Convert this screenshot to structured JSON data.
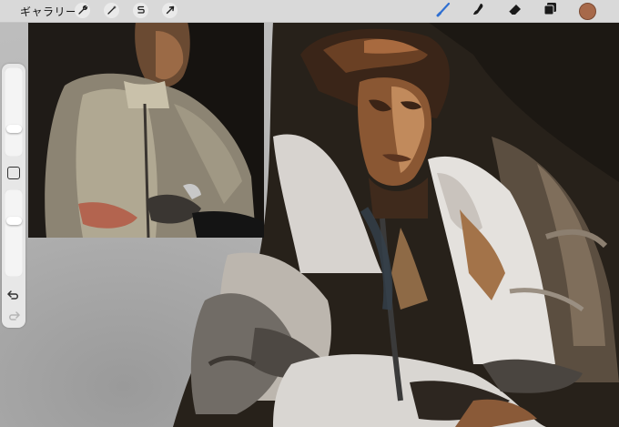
{
  "toolbar": {
    "gallery_label": "ギャラリー",
    "left_tools": [
      {
        "name": "actions",
        "icon": "wrench-icon"
      },
      {
        "name": "adjustments",
        "icon": "magic-wand-icon"
      },
      {
        "name": "selection",
        "icon": "selection-s-icon"
      },
      {
        "name": "transform",
        "icon": "arrow-cursor-icon"
      }
    ],
    "right_tools": [
      {
        "name": "brush",
        "icon": "brush-icon",
        "active": true
      },
      {
        "name": "smudge",
        "icon": "smudge-icon"
      },
      {
        "name": "eraser",
        "icon": "eraser-icon"
      },
      {
        "name": "layers",
        "icon": "layers-icon"
      }
    ],
    "current_color": "#a7694a",
    "active_tool_color": "#2f6fd1"
  },
  "sidebar": {
    "brush_size_level": 0.38,
    "opacity_level": 0.38,
    "undo_icon": "undo-icon",
    "redo_icon": "redo-icon"
  }
}
